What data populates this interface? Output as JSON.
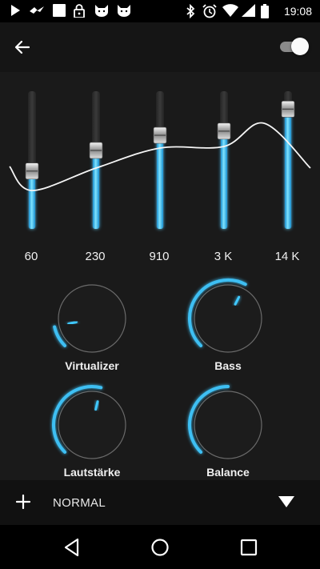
{
  "status_bar": {
    "time": "19:08",
    "left_icons": [
      "play-icon",
      "cast-bird-icon",
      "square-notification-icon",
      "lock-icon",
      "cat-icon",
      "cat-icon"
    ],
    "right_icons": [
      "bluetooth-icon",
      "alarm-icon",
      "wifi-icon",
      "signal-icon",
      "battery-icon"
    ]
  },
  "app_bar": {
    "back_icon": "arrow-back-icon",
    "enabled": true
  },
  "equalizer": {
    "accent_color": "#3fc8ff",
    "bands": [
      {
        "label": "60",
        "level": 0.42
      },
      {
        "label": "230",
        "level": 0.57
      },
      {
        "label": "910",
        "level": 0.68
      },
      {
        "label": "3 K",
        "level": 0.71
      },
      {
        "label": "14 K",
        "level": 0.87
      }
    ]
  },
  "knobs": [
    {
      "label": "Virtualizer",
      "value": 0.12
    },
    {
      "label": "Bass",
      "value": 0.6
    },
    {
      "label": "Lautstärke",
      "value": 0.55
    },
    {
      "label": "Balance",
      "value": 0.5
    }
  ],
  "preset_bar": {
    "add_icon": "plus-icon",
    "preset": "NORMAL",
    "dropdown_icon": "triangle-down-icon"
  },
  "nav_bar": {
    "icons": [
      "nav-back-icon",
      "nav-home-icon",
      "nav-recents-icon"
    ]
  }
}
